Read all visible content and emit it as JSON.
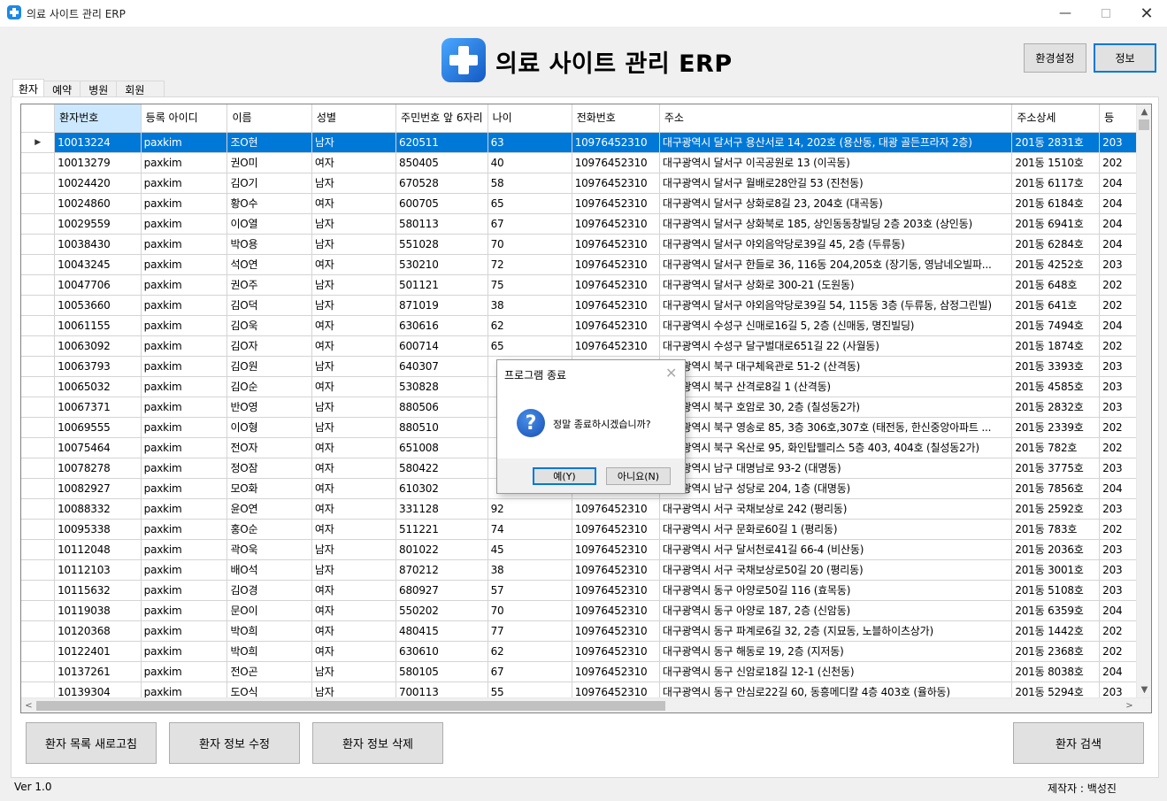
{
  "window": {
    "title": "의료 사이트 관리 ERP"
  },
  "header": {
    "title": "의료 사이트 관리 ERP",
    "settings_label": "환경설정",
    "info_label": "정보"
  },
  "tabs": [
    "환자",
    "예약",
    "병원",
    "회원"
  ],
  "grid": {
    "columns": [
      "환자번호",
      "등록 아이디",
      "이름",
      "성별",
      "주민번호 앞 6자리",
      "나이",
      "전화번호",
      "주소",
      "주소상세",
      "등"
    ],
    "rows": [
      [
        "10013224",
        "paxkim",
        "조O현",
        "남자",
        "620511",
        "63",
        "10976452310",
        "대구광역시 달서구 용산서로 14, 202호 (용산동, 대광 골든프라자 2층)",
        "201동 2831호",
        "203"
      ],
      [
        "10013279",
        "paxkim",
        "권O미",
        "여자",
        "850405",
        "40",
        "10976452310",
        "대구광역시 달서구 이곡공원로 13 (이곡동)",
        "201동 1510호",
        "202"
      ],
      [
        "10024420",
        "paxkim",
        "김O기",
        "남자",
        "670528",
        "58",
        "10976452310",
        "대구광역시 달서구 월배로28안길 53 (진천동)",
        "201동 6117호",
        "204"
      ],
      [
        "10024860",
        "paxkim",
        "황O수",
        "여자",
        "600705",
        "65",
        "10976452310",
        "대구광역시 달서구 상화로8길 23, 204호 (대곡동)",
        "201동 6184호",
        "204"
      ],
      [
        "10029559",
        "paxkim",
        "이O열",
        "남자",
        "580113",
        "67",
        "10976452310",
        "대구광역시 달서구 상화북로 185, 상인동동창빌딩 2층 203호 (상인동)",
        "201동 6941호",
        "204"
      ],
      [
        "10038430",
        "paxkim",
        "박O용",
        "남자",
        "551028",
        "70",
        "10976452310",
        "대구광역시 달서구 야외음악당로39길 45, 2층 (두류동)",
        "201동 6284호",
        "204"
      ],
      [
        "10043245",
        "paxkim",
        "석O연",
        "여자",
        "530210",
        "72",
        "10976452310",
        "대구광역시 달서구 한들로 36, 116동 204,205호 (장기동, 영남네오빌파...",
        "201동 4252호",
        "203"
      ],
      [
        "10047706",
        "paxkim",
        "권O주",
        "남자",
        "501121",
        "75",
        "10976452310",
        "대구광역시 달서구 상화로 300-21 (도원동)",
        "201동 648호",
        "202"
      ],
      [
        "10053660",
        "paxkim",
        "김O덕",
        "남자",
        "871019",
        "38",
        "10976452310",
        "대구광역시 달서구 야외음악당로39길 54, 115동 3층 (두류동, 삼정그린빌)",
        "201동 641호",
        "202"
      ],
      [
        "10061155",
        "paxkim",
        "김O욱",
        "여자",
        "630616",
        "62",
        "10976452310",
        "대구광역시 수성구 신매로16길 5, 2층 (신매동, 명진빌딩)",
        "201동 7494호",
        "204"
      ],
      [
        "10063092",
        "paxkim",
        "김O자",
        "여자",
        "600714",
        "65",
        "10976452310",
        "대구광역시 수성구 달구벌대로651길 22 (사월동)",
        "201동 1874호",
        "202"
      ],
      [
        "10063793",
        "paxkim",
        "김O원",
        "남자",
        "640307",
        "",
        "",
        "대구광역시 북구 대구체육관로 51-2 (산격동)",
        "201동 3393호",
        "203"
      ],
      [
        "10065032",
        "paxkim",
        "김O순",
        "여자",
        "530828",
        "",
        "",
        "대구광역시 북구 산격로8길 1 (산격동)",
        "201동 4585호",
        "203"
      ],
      [
        "10067371",
        "paxkim",
        "반O영",
        "남자",
        "880506",
        "",
        "",
        "대구광역시 북구 호암로 30, 2층 (칠성동2가)",
        "201동 2832호",
        "203"
      ],
      [
        "10069555",
        "paxkim",
        "이O형",
        "남자",
        "880510",
        "",
        "",
        "대구광역시 북구 영송로 85, 3층 306호,307호 (태전동, 한신중앙아파트 ...",
        "201동 2339호",
        "202"
      ],
      [
        "10075464",
        "paxkim",
        "전O자",
        "여자",
        "651008",
        "",
        "",
        "대구광역시 북구 옥산로 95, 화인탑펠리스 5층 403, 404호 (칠성동2가)",
        "201동 782호",
        "202"
      ],
      [
        "10078278",
        "paxkim",
        "정O잠",
        "여자",
        "580422",
        "",
        "",
        "대구광역시 남구 대명남로 93-2 (대명동)",
        "201동 3775호",
        "203"
      ],
      [
        "10082927",
        "paxkim",
        "모O화",
        "여자",
        "610302",
        "",
        "",
        "대구광역시 남구 성당로 204, 1층 (대명동)",
        "201동 7856호",
        "204"
      ],
      [
        "10088332",
        "paxkim",
        "윤O연",
        "여자",
        "331128",
        "92",
        "10976452310",
        "대구광역시 서구 국채보상로 242 (평리동)",
        "201동 2592호",
        "203"
      ],
      [
        "10095338",
        "paxkim",
        "홍O순",
        "여자",
        "511221",
        "74",
        "10976452310",
        "대구광역시 서구 문화로60길 1 (평리동)",
        "201동 783호",
        "202"
      ],
      [
        "10112048",
        "paxkim",
        "곽O욱",
        "남자",
        "801022",
        "45",
        "10976452310",
        "대구광역시 서구 달서천로41길 66-4 (비산동)",
        "201동 2036호",
        "203"
      ],
      [
        "10112103",
        "paxkim",
        "배O석",
        "남자",
        "870212",
        "38",
        "10976452310",
        "대구광역시 서구 국채보상로50길 20 (평리동)",
        "201동 3001호",
        "203"
      ],
      [
        "10115632",
        "paxkim",
        "김O경",
        "여자",
        "680927",
        "57",
        "10976452310",
        "대구광역시 동구 아양로50길 116 (효목동)",
        "201동 5108호",
        "203"
      ],
      [
        "10119038",
        "paxkim",
        "문O이",
        "여자",
        "550202",
        "70",
        "10976452310",
        "대구광역시 동구 아양로 187, 2층 (신암동)",
        "201동 6359호",
        "204"
      ],
      [
        "10120368",
        "paxkim",
        "박O희",
        "여자",
        "480415",
        "77",
        "10976452310",
        "대구광역시 동구 파계로6길 32, 2층 (지묘동, 노블하이츠상가)",
        "201동 1442호",
        "202"
      ],
      [
        "10122401",
        "paxkim",
        "박O희",
        "여자",
        "630610",
        "62",
        "10976452310",
        "대구광역시 동구 해동로 19, 2층 (지저동)",
        "201동 2368호",
        "202"
      ],
      [
        "10137261",
        "paxkim",
        "전O곤",
        "남자",
        "580105",
        "67",
        "10976452310",
        "대구광역시 동구 신암로18길 12-1 (신천동)",
        "201동 8038호",
        "204"
      ],
      [
        "10139304",
        "paxkim",
        "도O식",
        "남자",
        "700113",
        "55",
        "10976452310",
        "대구광역시 동구 안심로22길 60, 동흥메디칼 4층 403호 (율하동)",
        "201동 5294호",
        "203"
      ]
    ]
  },
  "buttons": {
    "refresh": "환자 목록 새로고침",
    "edit": "환자 정보 수정",
    "delete": "환자 정보 삭제",
    "search": "환자 검색"
  },
  "footer": {
    "version": "Ver 1.0",
    "author": "제작자 : 백성진"
  },
  "dialog": {
    "title": "프로그램 종료",
    "message": "정말 종료하시겠습니까?",
    "yes": "예(Y)",
    "no": "아니요(N)"
  },
  "colors": {
    "selection": "#0078d7",
    "header_selected": "#cce8ff",
    "accent": "#0078d7"
  }
}
